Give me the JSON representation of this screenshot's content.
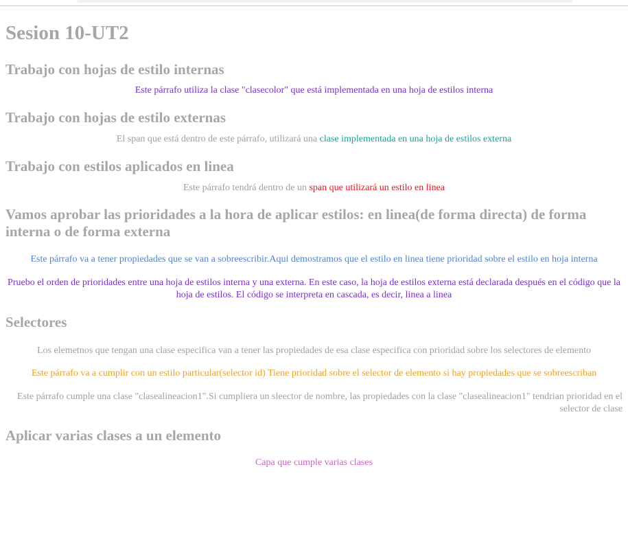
{
  "page": {
    "title": "Sesion 10-UT2",
    "sections": {
      "internas": {
        "heading": "Trabajo con hojas de estilo internas",
        "paragraph": "Este párrafo utiliza la clase \"clasecolor\" que está implementada en una hoja de estilos interna"
      },
      "externas": {
        "heading": "Trabajo con hojas de estilo externas",
        "paragraph_prefix": "El span que está dentro de este párrafo, utilizará una ",
        "paragraph_span": "clase implementada en una hoja de estilos externa"
      },
      "linea": {
        "heading": "Trabajo con estilos aplicados en linea",
        "paragraph_prefix": "Este párrafo tendrá dentro de un ",
        "paragraph_span": "span que utilizará un estilo en linea"
      },
      "prioridades": {
        "heading": "Vamos aprobar las prioridades a la hora de aplicar estilos: en linea(de forma directa) de forma interna o de forma externa",
        "paragraph1": "Este párrafo va a tener propiedades que se van a sobreescribir.Aqui demostramos que el estilo en linea tiene prioridad sobre el estilo en hoja interna",
        "paragraph2": "Pruebo el orden de prioridades entre una hoja de estilos interna y una externa. En este caso, la hoja de estilos externa está declarada después en el código que la hoja de estilos. El código se interpreta en cascada, es decir, linea a linea"
      },
      "selectores": {
        "heading": "Selectores",
        "paragraph1": "Los elemetnos que tengan una clase especifica van a tener las propiedades de esa clase especifica con prioridad sobre los selectores de elemento",
        "paragraph2": "Este párrafo va a cumplir con un estilo particular(selector id) Tiene prioridad sobre el selector de elemento si hay propiedades que se sobreescriban",
        "paragraph3": "Este párrafo cumple una clase \"clasealineacion1\".Si cumpliera un sleector de nombre, las propiedades con la clase \"clasealineacion1\" tendrian prioridad en el selector de clase"
      },
      "varias_clases": {
        "heading": "Aplicar varias clases a un elemento",
        "paragraph": "Capa que cumple varias clases"
      }
    }
  },
  "colors": {
    "heading_grey": "#a6a6a6",
    "purple": "#7a2fd0",
    "teal": "#17a39a",
    "red": "#e8151b",
    "blue": "#4e82d6",
    "orange": "#f2a21d",
    "pink": "#d35fc9",
    "grey": "#a0a0a0"
  }
}
